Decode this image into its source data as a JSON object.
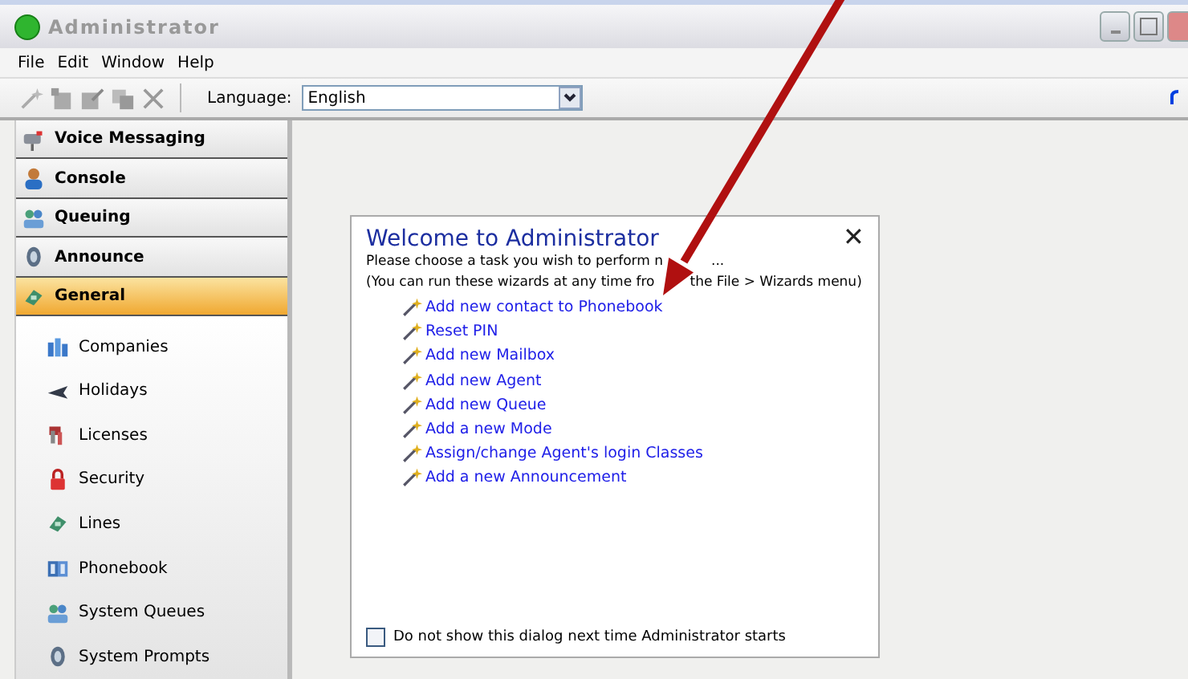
{
  "window": {
    "title": "Administrator"
  },
  "menu": [
    "File",
    "Edit",
    "Window",
    "Help"
  ],
  "toolbar": {
    "language_label": "Language:",
    "language_value": "English"
  },
  "sections": [
    {
      "label": "Voice Messaging",
      "selected": false
    },
    {
      "label": "Console",
      "selected": false
    },
    {
      "label": "Queuing",
      "selected": false
    },
    {
      "label": "Announce",
      "selected": false
    },
    {
      "label": "General",
      "selected": true
    }
  ],
  "general_items": [
    "Companies",
    "Holidays",
    "Licenses",
    "Security",
    "Lines",
    "Phonebook",
    "System Queues",
    "System Prompts"
  ],
  "dialog": {
    "title": "Welcome to Administrator",
    "close": "✕",
    "intro": [
      "Please choose a task you wish to perform n",
      "..."
    ],
    "hint": [
      "(You can run these wizards at any time fro",
      "the File > Wizards menu)"
    ],
    "tasks": [
      "Add new contact to Phonebook",
      "Reset PIN",
      "Add new Mailbox",
      "Add new Agent",
      "Add new Queue",
      "Add a new Mode",
      "Assign/change Agent's login Classes",
      "Add a new Announcement"
    ],
    "dont_show": {
      "label": "Do not show this dialog next time Administrator starts",
      "checked": false
    }
  }
}
